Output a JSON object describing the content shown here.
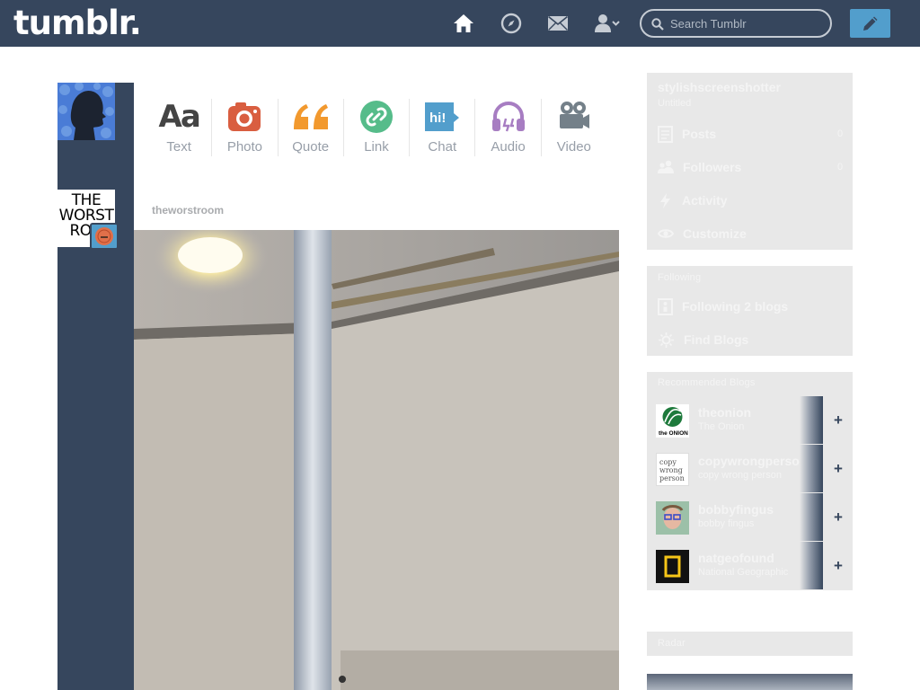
{
  "header": {
    "logo": "tumblr.",
    "search_placeholder": "Search Tumblr",
    "nav_icons": [
      "home-icon",
      "explore-icon",
      "inbox-icon",
      "account-icon",
      "search-icon",
      "compose-icon"
    ],
    "colors": {
      "bar": "#36465d",
      "compose": "#529ecc"
    }
  },
  "post_types": [
    {
      "label": "Text",
      "icon": "text-icon",
      "color": "#444444"
    },
    {
      "label": "Photo",
      "icon": "camera-icon",
      "color": "#d95e40"
    },
    {
      "label": "Quote",
      "icon": "quote-icon",
      "color": "#f2992e"
    },
    {
      "label": "Link",
      "icon": "link-icon",
      "color": "#56bc8a"
    },
    {
      "label": "Chat",
      "icon": "chat-icon",
      "color": "#529ecc"
    },
    {
      "label": "Audio",
      "icon": "headphones-icon",
      "color": "#a77dc2"
    },
    {
      "label": "Video",
      "icon": "video-camera-icon",
      "color": "#748089"
    }
  ],
  "post": {
    "blog_name": "theworstroom",
    "avatar_text": [
      "THE",
      "WORST",
      "ROO"
    ]
  },
  "sidebar": {
    "account": {
      "blog": "stylishscreenshotter",
      "blog_sub": "Untitled",
      "items": [
        {
          "label": "Posts",
          "count": "0",
          "icon": "posts-icon"
        },
        {
          "label": "Followers",
          "count": "0",
          "icon": "followers-icon"
        },
        {
          "label": "Activity",
          "icon": "activity-icon"
        },
        {
          "label": "Customize",
          "icon": "customize-icon"
        }
      ]
    },
    "following": {
      "title": "Following",
      "items": [
        {
          "label": "Following 2 blogs",
          "icon": "following-icon"
        },
        {
          "label": "Find Blogs",
          "icon": "find-blogs-icon"
        }
      ]
    },
    "recommended": {
      "title": "Recommended Blogs",
      "blogs": [
        {
          "name": "theonion",
          "sub": "The Onion",
          "thumb_bg": "#ffffff"
        },
        {
          "name": "copywrongperson",
          "sub": "copy wrong person",
          "thumb_bg": "#ffffff"
        },
        {
          "name": "bobbyfingus",
          "sub": "bobby fingus",
          "thumb_bg": "#9db4c8"
        },
        {
          "name": "natgeofound",
          "sub": "National Geographic",
          "thumb_bg": "#111111"
        }
      ]
    },
    "radar": {
      "title": "Radar"
    }
  }
}
